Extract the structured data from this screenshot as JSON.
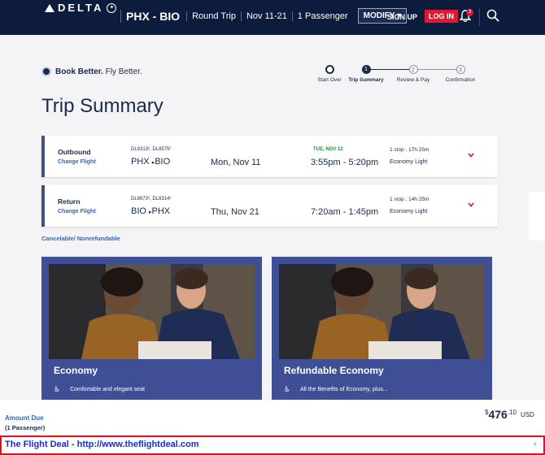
{
  "header": {
    "brand": "DELTA",
    "route": "PHX - BIO",
    "trip_type": "Round Trip",
    "dates": "Nov 11-21",
    "passengers": "1 Passenger",
    "modify_label": "MODIFY",
    "signup_label": "SIGN UP",
    "login_label": "LOG IN",
    "notification_count": "3"
  },
  "book_better": {
    "bold": "Book Better.",
    "rest": " Fly Better."
  },
  "steps": [
    {
      "label": "Start Over",
      "num": ""
    },
    {
      "label": "Trip Summary",
      "num": "1"
    },
    {
      "label": "Review & Pay",
      "num": "2"
    },
    {
      "label": "Confirmation",
      "num": "3"
    }
  ],
  "page_title": "Trip Summary",
  "flights": [
    {
      "kind": "Outbound",
      "change": "Change Flight",
      "flight_numbers": "DL8313², DL8575²",
      "from": "PHX",
      "to": "BIO",
      "date": "Mon, Nov 11",
      "next_day": "TUE, NOV 12",
      "times": "3:55pm -  5:20pm",
      "stops": "1 stop , 17h 25m",
      "cabin": "Economy Light"
    },
    {
      "kind": "Return",
      "change": "Change Flight",
      "flight_numbers": "DL8673², DL8314²",
      "from": "BIO",
      "to": "PHX",
      "date": "Thu, Nov 21",
      "next_day": "",
      "times": "7:20am -  1:45pm",
      "stops": "1 stop , 14h 25m",
      "cabin": "Economy Light"
    }
  ],
  "cancel_policy": "Cancelable/ Nonrefundable",
  "fares": [
    {
      "title": "Economy",
      "feature": "Comfortable and elegant seat"
    },
    {
      "title": "Refundable Economy",
      "feature": "All the Benefits of Economy, plus..."
    }
  ],
  "amount": {
    "label": "Amount Due",
    "passengers": "(1 Passenger)",
    "currency_symbol": "$",
    "dollars": "476",
    "cents": ".10",
    "currency": "USD"
  },
  "banner": {
    "text": "The Flight Deal - http://www.theflightdeal.com",
    "close": "x"
  },
  "colors": {
    "navy": "#0d1b3c",
    "red": "#e01933",
    "blue_link": "#3566b8",
    "fare_bg": "#3e4f95"
  }
}
